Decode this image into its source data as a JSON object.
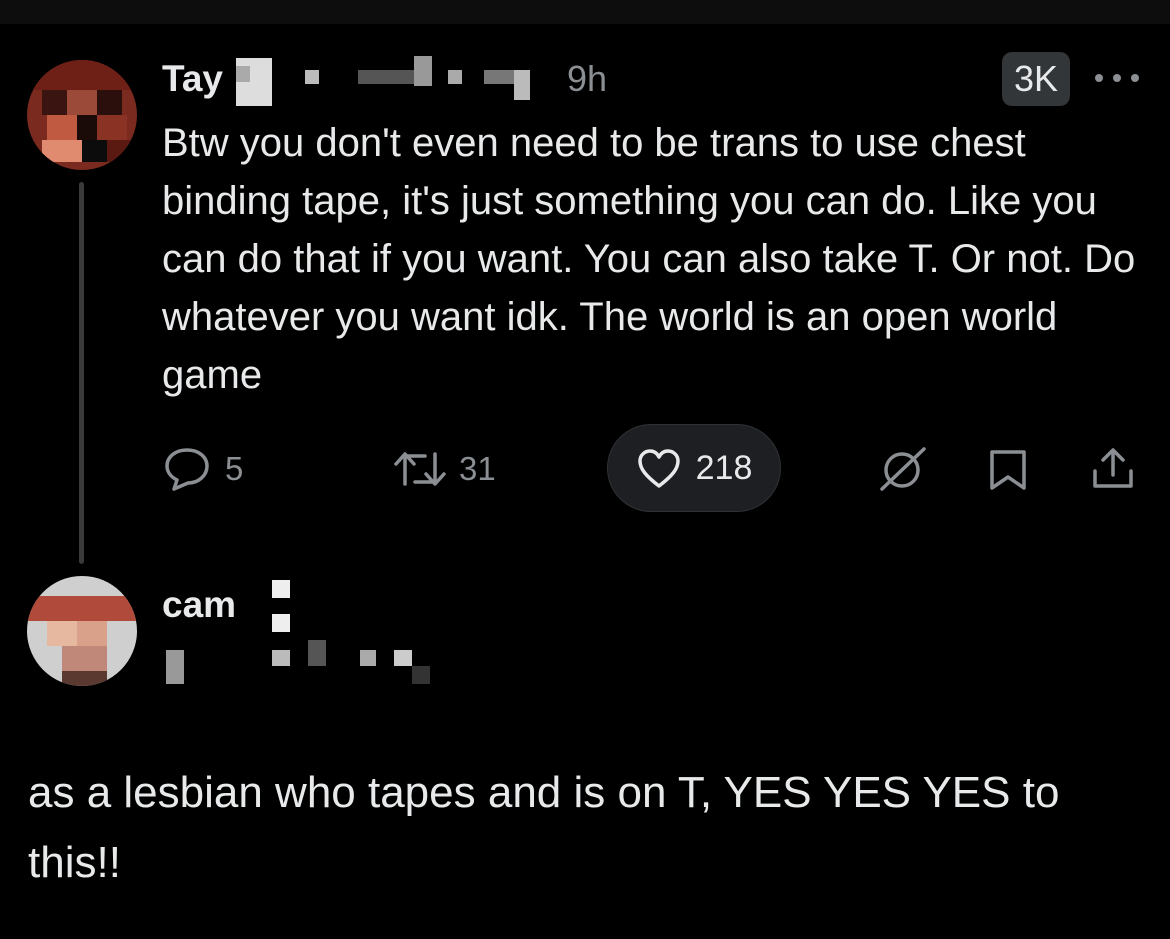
{
  "post": {
    "author_name": "Tay",
    "time": "9h",
    "views": "3K",
    "text": "Btw you don't even need to be trans to use chest binding tape, it's just something you can do. Like you can do that if you want. You can also take T. Or not. Do whatever you want idk. The world is an open world game",
    "stats": {
      "replies": "5",
      "reposts": "31",
      "likes": "218"
    },
    "icons": {
      "reply": "reply-icon",
      "repost": "repost-icon",
      "like": "heart-icon",
      "grok": "grok-icon",
      "bookmark": "bookmark-icon",
      "share": "share-icon",
      "more": "more-icon"
    }
  },
  "reply": {
    "author_name": "cam",
    "text": "as a lesbian who tapes and is on T, YES YES YES to this!!"
  },
  "colors": {
    "background": "#000000",
    "text": "#e7e9ea",
    "muted": "#8b8f94",
    "badge": "#333639",
    "thread_line": "#3a3a3a"
  }
}
